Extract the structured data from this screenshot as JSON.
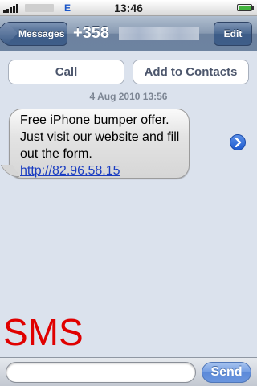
{
  "status_bar": {
    "network": "E",
    "time": "13:46"
  },
  "nav": {
    "back_label": "Messages",
    "title": "+358",
    "edit_label": "Edit"
  },
  "actions": {
    "call_label": "Call",
    "add_contacts_label": "Add to Contacts"
  },
  "conversation": {
    "timestamp": "4 Aug 2010 13:56",
    "message_lines": [
      "Free iPhone bumper offer.",
      "Just visit our website and fill",
      "out the form."
    ],
    "message_link": "http://82.96.58.15"
  },
  "overlay_label": "SMS",
  "compose": {
    "send_label": "Send"
  },
  "colors": {
    "overlay_text": "#e00000",
    "link": "#1a3dc1",
    "send_button": "#6f9ae2"
  },
  "icons": [
    "signal-bars-icon",
    "battery-icon",
    "back-chevron-icon",
    "disclosure-arrow-icon"
  ]
}
